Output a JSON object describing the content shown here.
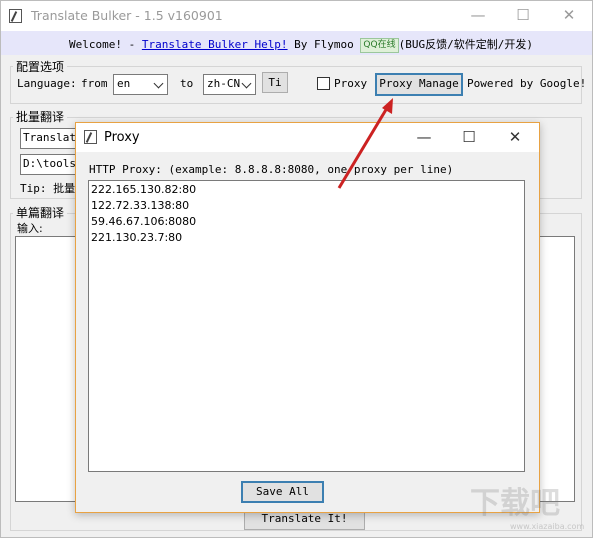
{
  "main_window": {
    "title": "Translate Bulker - 1.5 v160901",
    "controls": {
      "minimize": "—",
      "maximize": "☐",
      "close": "✕"
    }
  },
  "welcome_bar": {
    "prefix": "Welcome! - ",
    "link": "Translate Bulker Help!",
    "by": " By Flymoo ",
    "qq_badge": "QQ在线",
    "suffix": "(BUG反馈/软件定制/开发)"
  },
  "config": {
    "group_title": "配置选项",
    "language_label": "Language:",
    "from_label": "from",
    "from_value": "en",
    "to_label": "to",
    "to_value": "zh-CN",
    "ti_button": "Ti",
    "proxy_checkbox_label": "Proxy",
    "proxy_manage_button": "Proxy Manage",
    "powered_by": "Powered by Google!"
  },
  "batch": {
    "group_title": "批量翻译",
    "field1_value": "Translate",
    "field2_value": "D:\\tools\\",
    "tip_label": "Tip: 批量"
  },
  "single": {
    "group_title": "单篇翻译",
    "input_label": "输入:",
    "translate_button": "Translate It!"
  },
  "proxy_dialog": {
    "title": "Proxy",
    "controls": {
      "minimize": "—",
      "maximize": "☐",
      "close": "✕"
    },
    "hint": "HTTP Proxy: (example: 8.8.8.8:8080, one proxy per line)",
    "proxies": [
      "222.165.130.82:80",
      "122.72.33.138:80",
      "59.46.67.106:8080",
      "221.130.23.7:80"
    ],
    "save_button": "Save All"
  },
  "watermark": {
    "main": "下载吧",
    "sub": "www.xiazaiba.com"
  },
  "colors": {
    "welcome_bg": "#e6e6fa",
    "link": "#0000cc",
    "arrow": "#cc2222",
    "focus_border": "#3c7fb1",
    "dialog_border": "#e8a243"
  }
}
